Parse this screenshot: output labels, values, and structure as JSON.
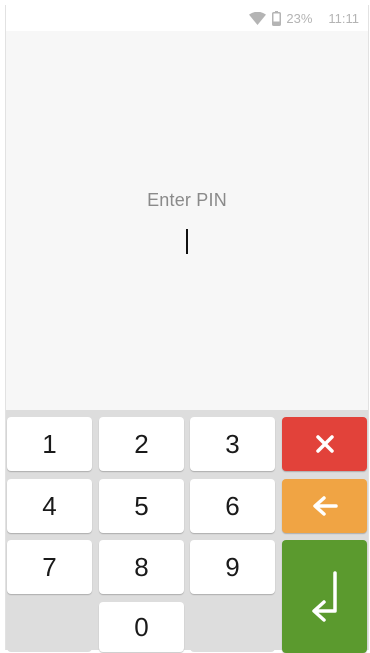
{
  "status_bar": {
    "battery_percent": "23%",
    "time": "11:11",
    "icons": [
      "wifi-icon",
      "battery-icon"
    ]
  },
  "pin": {
    "label": "Enter PIN",
    "value": ""
  },
  "keypad": {
    "digits": [
      "1",
      "2",
      "3",
      "4",
      "5",
      "6",
      "7",
      "8",
      "9",
      "0"
    ],
    "clear": {
      "icon": "close-icon",
      "color": "#e2423a"
    },
    "backspace": {
      "icon": "arrow-left-icon",
      "color": "#f0a444"
    },
    "enter": {
      "icon": "enter-return-icon",
      "color": "#5b9a2e"
    }
  }
}
